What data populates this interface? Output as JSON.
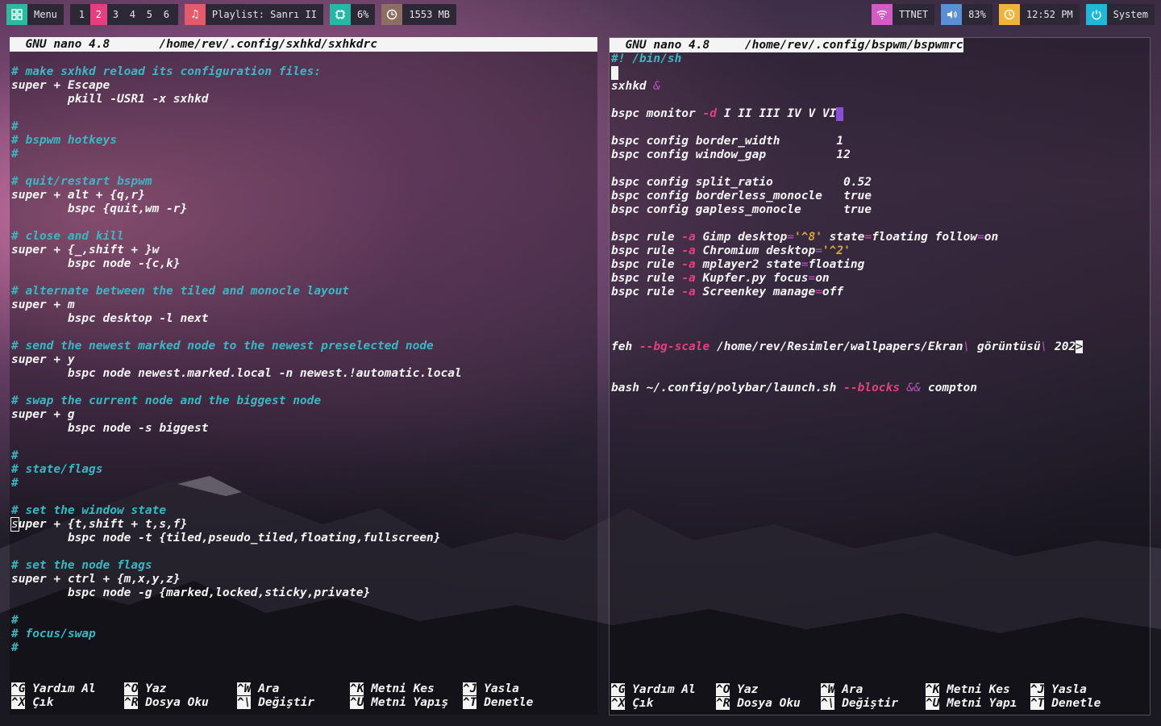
{
  "topbar": {
    "menu_label": "Menu",
    "workspaces": [
      "1",
      "2",
      "3",
      "4",
      "5",
      "6"
    ],
    "active_workspace": "2",
    "playlist": "Playlist: Sanrı II",
    "cpu": "6%",
    "memory": "1553 MB",
    "network": "TTNET",
    "volume": "83%",
    "clock": "12:52 PM",
    "power_label": "System",
    "colors": {
      "menu": "#2fb7a0",
      "music": "#e35a6b",
      "cpu": "#26b7a5",
      "memory": "#8d6e63",
      "wifi": "#d65ac6",
      "volume": "#5a8fd6",
      "clock": "#f0b43c",
      "power": "#1fb8d6",
      "active_ws": "#e5407e"
    }
  },
  "left_editor": {
    "title_app": "GNU nano 4.8",
    "title_file": "/home/rev/.config/sxhkd/sxhkdrc",
    "lines": [
      {
        "t": "# make sxhkd reload its configuration files:",
        "c": true
      },
      {
        "t": "super + Escape"
      },
      {
        "t": "        pkill -USR1 -x sxhkd"
      },
      {
        "t": ""
      },
      {
        "t": "#",
        "c": true
      },
      {
        "t": "# bspwm hotkeys",
        "c": true
      },
      {
        "t": "#",
        "c": true
      },
      {
        "t": ""
      },
      {
        "t": "# quit/restart bspwm",
        "c": true
      },
      {
        "t": "super + alt + {q,r}"
      },
      {
        "t": "        bspc {quit,wm -r}"
      },
      {
        "t": ""
      },
      {
        "t": "# close and kill",
        "c": true
      },
      {
        "t": "super + {_,shift + }w"
      },
      {
        "t": "        bspc node -{c,k}"
      },
      {
        "t": ""
      },
      {
        "t": "# alternate between the tiled and monocle layout",
        "c": true
      },
      {
        "t": "super + m"
      },
      {
        "t": "        bspc desktop -l next"
      },
      {
        "t": ""
      },
      {
        "t": "# send the newest marked node to the newest preselected node",
        "c": true
      },
      {
        "t": "super + y"
      },
      {
        "t": "        bspc node newest.marked.local -n newest.!automatic.local"
      },
      {
        "t": ""
      },
      {
        "t": "# swap the current node and the biggest node",
        "c": true
      },
      {
        "t": "super + g"
      },
      {
        "t": "        bspc node -s biggest"
      },
      {
        "t": ""
      },
      {
        "t": "#",
        "c": true
      },
      {
        "t": "# state/flags",
        "c": true
      },
      {
        "t": "#",
        "c": true
      },
      {
        "t": ""
      },
      {
        "t": "# set the window state",
        "c": true
      },
      {
        "t": "super + {t,shift + t,s,f}",
        "cur": true
      },
      {
        "t": "        bspc node -t {tiled,pseudo_tiled,floating,fullscreen}"
      },
      {
        "t": ""
      },
      {
        "t": "# set the node flags",
        "c": true
      },
      {
        "t": "super + ctrl + {m,x,y,z}"
      },
      {
        "t": "        bspc node -g {marked,locked,sticky,private}"
      },
      {
        "t": ""
      },
      {
        "t": "#",
        "c": true
      },
      {
        "t": "# focus/swap",
        "c": true
      },
      {
        "t": "#",
        "c": true
      }
    ],
    "help_row1": [
      {
        "key": "^G",
        "label": "Yardım Al"
      },
      {
        "key": "^O",
        "label": "Yaz"
      },
      {
        "key": "^W",
        "label": "Ara"
      },
      {
        "key": "^K",
        "label": "Metni Kes"
      },
      {
        "key": "^J",
        "label": "Yasla"
      }
    ],
    "help_row2": [
      {
        "key": "^X",
        "label": "Çık"
      },
      {
        "key": "^R",
        "label": "Dosya Oku"
      },
      {
        "key": "^\\",
        "label": "Değiştir"
      },
      {
        "key": "^U",
        "label": "Metni Yapış"
      },
      {
        "key": "^T",
        "label": "Denetle"
      }
    ]
  },
  "right_editor": {
    "title_app": "GNU nano 4.8",
    "title_file": "/home/rev/.config/bspwm/bspwmrc",
    "shebang": "#! /bin/sh",
    "sxhkd_cmd": "sxhkd",
    "sxhkd_amp": "&",
    "monitor": {
      "cmd": "bspc monitor",
      "opt": "-d",
      "args": "I II III IV V VI"
    },
    "configs": [
      {
        "key": "bspc config border_width",
        "val": "        1"
      },
      {
        "key": "bspc config window_gap",
        "val": "          12"
      },
      {
        "blank": true
      },
      {
        "key": "bspc config split_ratio",
        "val": "          0.52"
      },
      {
        "key": "bspc config borderless_monocle",
        "val": "   true"
      },
      {
        "key": "bspc config gapless_monocle",
        "val": "      true"
      }
    ],
    "rules": [
      {
        "pre": "bspc rule ",
        "opt": "-a",
        "name": " Gimp desktop",
        "eq1": "=",
        "str1": "'^8'",
        "rest": " state",
        "eq2": "=",
        "v2": "floating follow",
        "eq3": "=",
        "v3": "on"
      },
      {
        "pre": "bspc rule ",
        "opt": "-a",
        "name": " Chromium desktop",
        "eq1": "=",
        "str1": "'^2'"
      },
      {
        "pre": "bspc rule ",
        "opt": "-a",
        "name": " mplayer2 state",
        "eq1": "=",
        "v1": "floating"
      },
      {
        "pre": "bspc rule ",
        "opt": "-a",
        "name": " Kupfer.py focus",
        "eq1": "=",
        "v1": "on"
      },
      {
        "pre": "bspc rule ",
        "opt": "-a",
        "name": " Screenkey manage",
        "eq1": "=",
        "v1": "off"
      }
    ],
    "feh": {
      "cmd": "feh ",
      "opt": "--bg-scale",
      "path1": " /home/rev/Resimler/wallpapers/Ekran",
      "esc1": "\\",
      "path2": " görüntüsü",
      "esc2": "\\",
      "path3": " 202",
      "overflow": ">"
    },
    "bash": {
      "cmd": "bash ~/.config/polybar/launch.sh ",
      "opt": "--blocks",
      "and": " &&",
      "rest": " compton"
    },
    "help_row1": [
      {
        "key": "^G",
        "label": "Yardım Al"
      },
      {
        "key": "^O",
        "label": "Yaz"
      },
      {
        "key": "^W",
        "label": "Ara"
      },
      {
        "key": "^K",
        "label": "Metni Kes"
      },
      {
        "key": "^J",
        "label": "Yasla"
      }
    ],
    "help_row2": [
      {
        "key": "^X",
        "label": "Çık"
      },
      {
        "key": "^R",
        "label": "Dosya Oku"
      },
      {
        "key": "^\\",
        "label": "Değiştir"
      },
      {
        "key": "^U",
        "label": "Metni Yapı"
      },
      {
        "key": "^T",
        "label": "Denetle"
      }
    ]
  }
}
